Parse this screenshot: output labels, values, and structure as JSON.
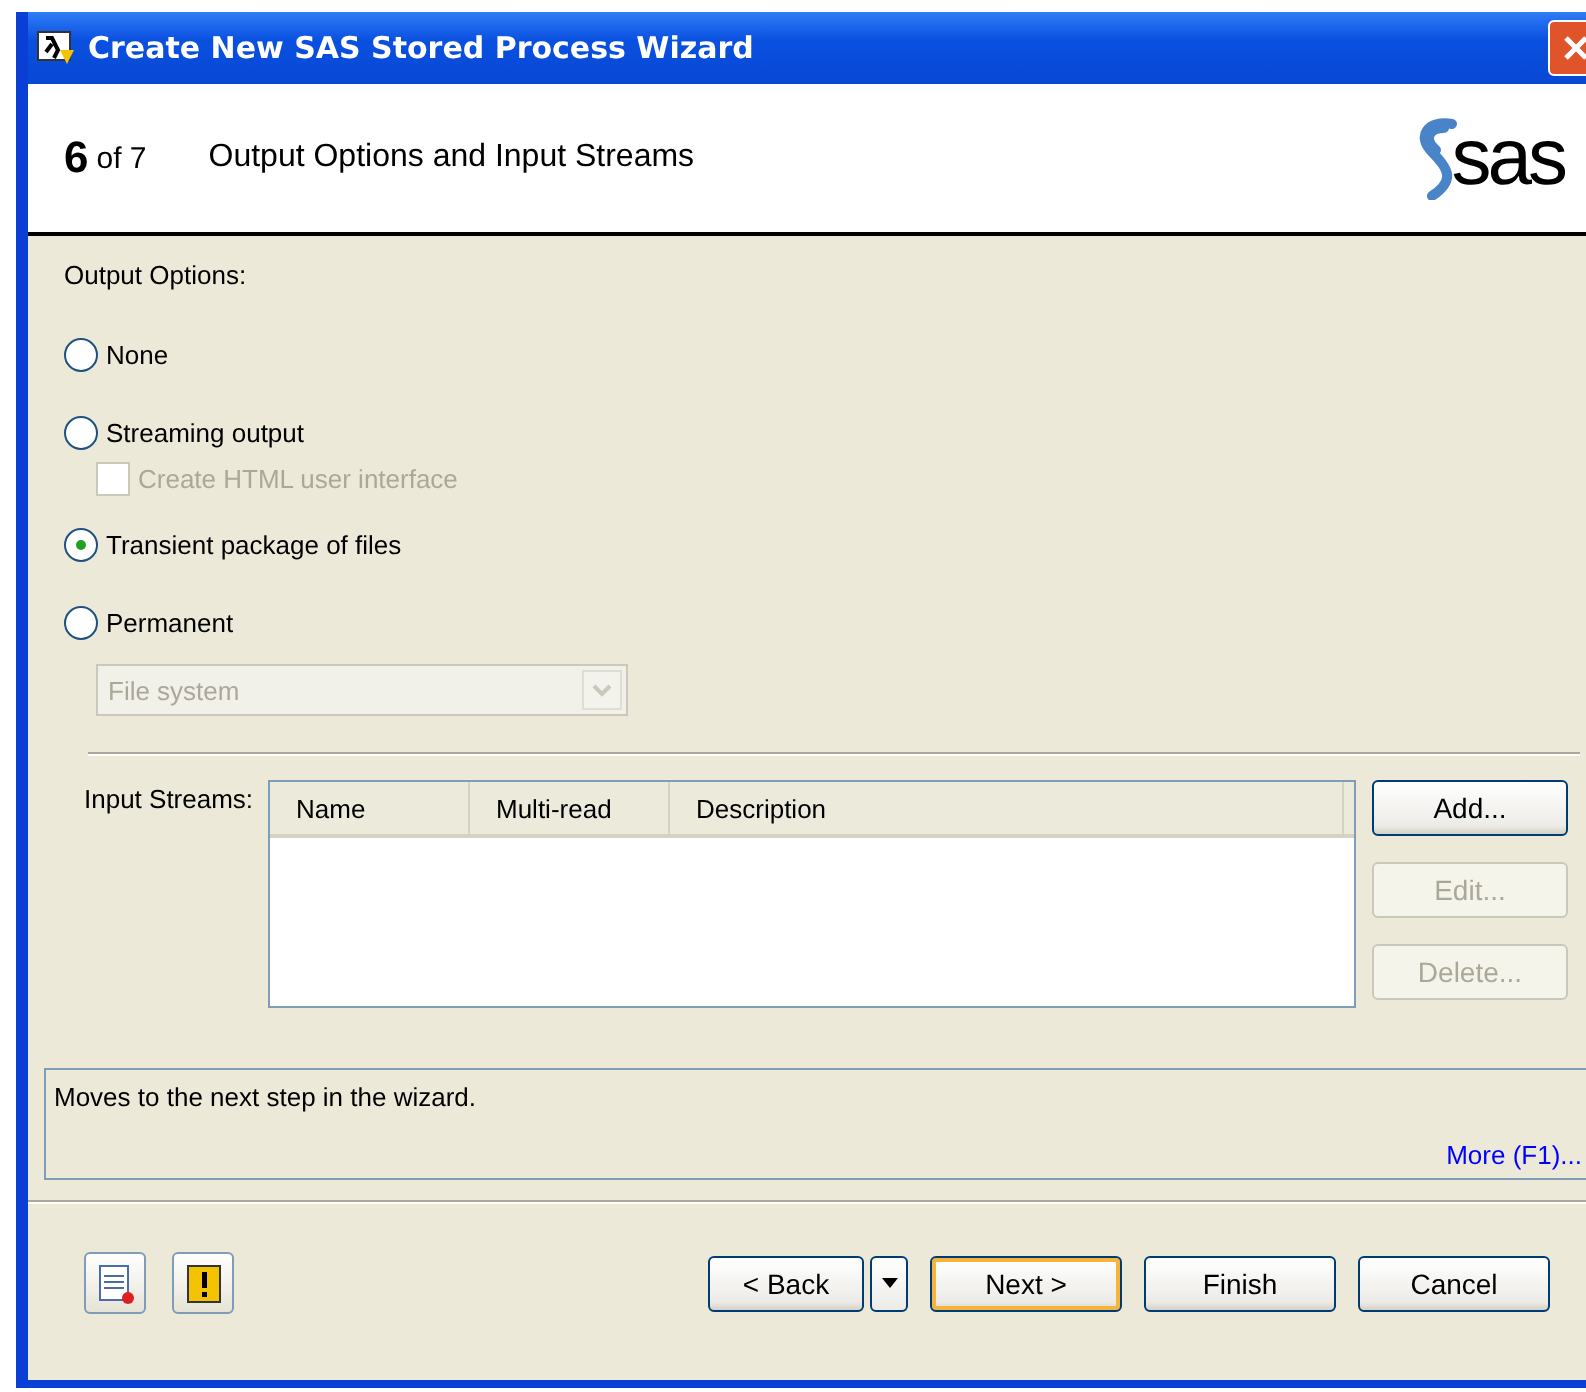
{
  "window": {
    "title": "Create New SAS Stored Process Wizard"
  },
  "header": {
    "step": "6",
    "of": "of 7",
    "title": "Output Options and Input Streams",
    "logo": "sas"
  },
  "output_options": {
    "label": "Output Options:",
    "items": [
      {
        "kind": "radio",
        "label": "None",
        "selected": false
      },
      {
        "kind": "radio",
        "label": "Streaming output",
        "selected": false
      },
      {
        "kind": "checkbox",
        "label": "Create HTML user interface",
        "checked": false,
        "disabled": true
      },
      {
        "kind": "radio",
        "label": "Transient package of files",
        "selected": true
      },
      {
        "kind": "radio",
        "label": "Permanent",
        "selected": false
      },
      {
        "kind": "dropdown",
        "value": "File system",
        "disabled": true
      }
    ]
  },
  "input_streams": {
    "label": "Input Streams:",
    "columns": [
      "Name",
      "Multi-read",
      "Description"
    ],
    "buttons": [
      {
        "label": "Add...",
        "disabled": false
      },
      {
        "label": "Edit...",
        "disabled": true
      },
      {
        "label": "Delete...",
        "disabled": true
      }
    ]
  },
  "status": {
    "text": "Moves to the next step in the wizard.",
    "link": "More (F1)..."
  },
  "footer": {
    "buttons": [
      {
        "kind": "button",
        "label": "< Back",
        "default": false
      },
      {
        "kind": "menu-arrow"
      },
      {
        "kind": "button",
        "label": "Next >",
        "default": true
      },
      {
        "kind": "button",
        "label": "Finish",
        "default": false
      },
      {
        "kind": "button",
        "label": "Cancel",
        "default": false
      }
    ]
  }
}
